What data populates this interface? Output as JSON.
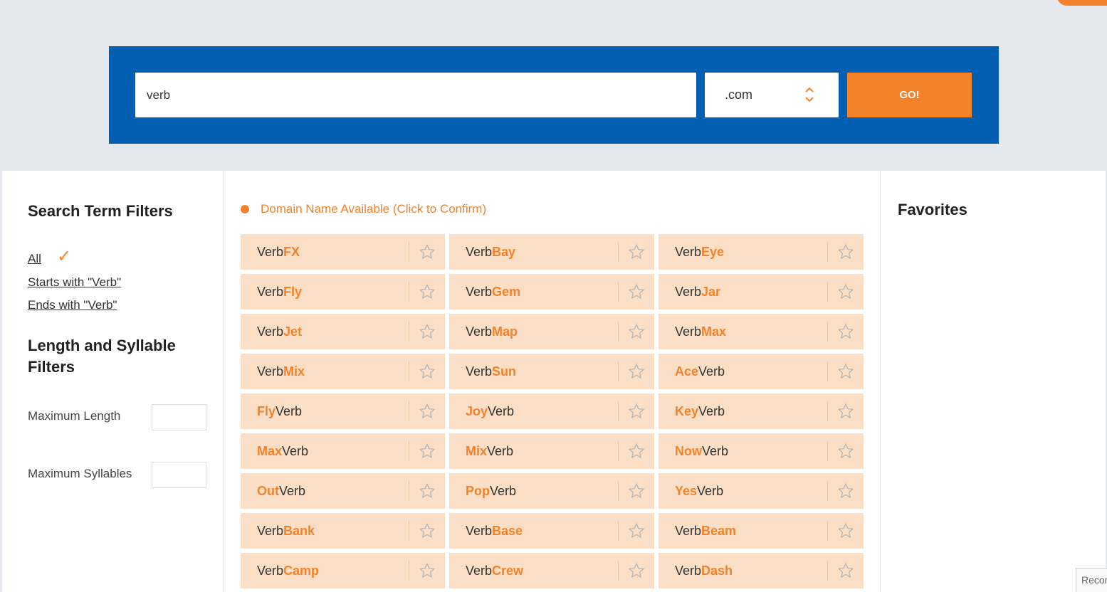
{
  "search": {
    "query": "verb",
    "tld": ".com",
    "go_label": "GO!"
  },
  "filters": {
    "search_term_title": "Search Term Filters",
    "options": [
      "All",
      "Starts with \"Verb\"",
      "Ends with \"Verb\""
    ],
    "length_title": "Length and Syllable Filters",
    "max_length_label": "Maximum Length",
    "max_syllables_label": "Maximum Syllables"
  },
  "legend": "Domain Name Available (Click to Confirm)",
  "favorites_title": "Favorites",
  "recorder_label": "Recor",
  "results": [
    {
      "pre": "Verb",
      "hl": "FX",
      "post": ""
    },
    {
      "pre": "Verb",
      "hl": "Bay",
      "post": ""
    },
    {
      "pre": "Verb",
      "hl": "Eye",
      "post": ""
    },
    {
      "pre": "Verb",
      "hl": "Fly",
      "post": ""
    },
    {
      "pre": "Verb",
      "hl": "Gem",
      "post": ""
    },
    {
      "pre": "Verb",
      "hl": "Jar",
      "post": ""
    },
    {
      "pre": "Verb",
      "hl": "Jet",
      "post": ""
    },
    {
      "pre": "Verb",
      "hl": "Map",
      "post": ""
    },
    {
      "pre": "Verb",
      "hl": "Max",
      "post": ""
    },
    {
      "pre": "Verb",
      "hl": "Mix",
      "post": ""
    },
    {
      "pre": "Verb",
      "hl": "Sun",
      "post": ""
    },
    {
      "pre": "",
      "hl": "Ace",
      "post": "Verb"
    },
    {
      "pre": "",
      "hl": "Fly",
      "post": "Verb"
    },
    {
      "pre": "",
      "hl": "Joy",
      "post": "Verb"
    },
    {
      "pre": "",
      "hl": "Key",
      "post": "Verb"
    },
    {
      "pre": "",
      "hl": "Max",
      "post": "Verb"
    },
    {
      "pre": "",
      "hl": "Mix",
      "post": "Verb"
    },
    {
      "pre": "",
      "hl": "Now",
      "post": "Verb"
    },
    {
      "pre": "",
      "hl": "Out",
      "post": "Verb"
    },
    {
      "pre": "",
      "hl": "Pop",
      "post": "Verb"
    },
    {
      "pre": "",
      "hl": "Yes",
      "post": "Verb"
    },
    {
      "pre": "Verb",
      "hl": "Bank",
      "post": ""
    },
    {
      "pre": "Verb",
      "hl": "Base",
      "post": ""
    },
    {
      "pre": "Verb",
      "hl": "Beam",
      "post": ""
    },
    {
      "pre": "Verb",
      "hl": "Camp",
      "post": ""
    },
    {
      "pre": "Verb",
      "hl": "Crew",
      "post": ""
    },
    {
      "pre": "Verb",
      "hl": "Dash",
      "post": ""
    }
  ],
  "colors": {
    "brand_blue": "#005fb1",
    "accent_orange": "#f4822a",
    "result_bg": "#fadfc6"
  },
  "icons": {
    "favorite": "star-outline-icon",
    "select": "chevron-up-down-icon",
    "selected": "check-icon",
    "availability": "orange-dot-icon"
  }
}
